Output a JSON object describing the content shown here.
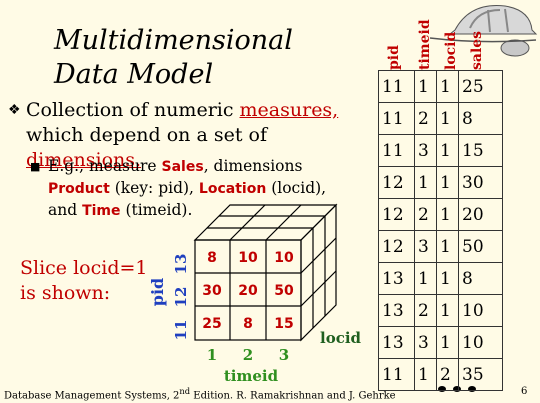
{
  "title": {
    "line1": "Multidimensional",
    "line2": "Data Model"
  },
  "bullet": {
    "glyph": "❖",
    "prefix": "Collection of numeric ",
    "measures": "measures,",
    "middle": "which depend on a set of ",
    "dimensions": "dimensions."
  },
  "subbullet": {
    "glyph": "■",
    "t1": "E.g., measure ",
    "sales": "Sales",
    "t2": ", dimensions",
    "product": "Product",
    "t3": " (key: pid), ",
    "location": "Location",
    "t4": " (locid),",
    "t5": "and ",
    "time": "Time",
    "t6": " (timeid)."
  },
  "slice": {
    "line1": "Slice locid=1",
    "line2": "is shown:"
  },
  "cube": {
    "pid_label": "pid",
    "pid_ticks": [
      "13",
      "12",
      "11"
    ],
    "timeid_label": "timeid",
    "timeid_ticks": [
      "1",
      "2",
      "3"
    ],
    "locid_label": "locid",
    "cells": [
      [
        "8",
        "10",
        "10"
      ],
      [
        "30",
        "20",
        "50"
      ],
      [
        "25",
        "8",
        "15"
      ]
    ],
    "colors": {
      "pid": "#1f3fbf",
      "timeid": "#2f8f1f",
      "locid": "#1f5f1f",
      "cell": "#c00000"
    }
  },
  "table": {
    "headers": [
      "pid",
      "timeid",
      "locid",
      "sales"
    ],
    "rows": [
      [
        "11",
        "1",
        "1",
        "25"
      ],
      [
        "11",
        "2",
        "1",
        "8"
      ],
      [
        "11",
        "3",
        "1",
        "15"
      ],
      [
        "12",
        "1",
        "1",
        "30"
      ],
      [
        "12",
        "2",
        "1",
        "20"
      ],
      [
        "12",
        "3",
        "1",
        "50"
      ],
      [
        "13",
        "1",
        "1",
        "8"
      ],
      [
        "13",
        "2",
        "1",
        "10"
      ],
      [
        "13",
        "3",
        "1",
        "10"
      ],
      [
        "11",
        "1",
        "2",
        "35"
      ]
    ]
  },
  "footer": {
    "text_pre": "Database Management Systems, 2",
    "sup": "nd",
    "text_post": " Edition. R. Ramakrishnan and J. Gehrke",
    "page": "6"
  }
}
